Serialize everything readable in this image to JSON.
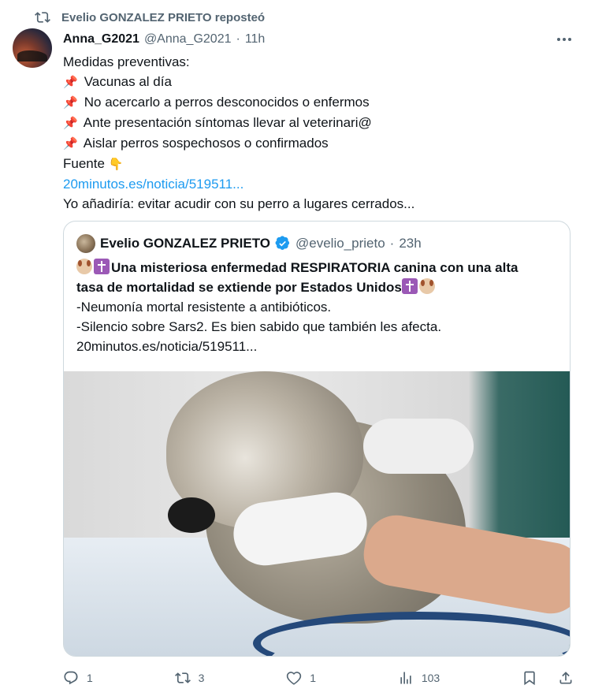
{
  "repost": {
    "label": "Evelio GONZALEZ PRIETO reposteó",
    "icon": "repost-icon"
  },
  "tweet": {
    "author_name": "Anna_G2021",
    "author_handle": "@Anna_G2021",
    "separator": "·",
    "time": "11h",
    "lines": [
      "Medidas preventivas:",
      "Vacunas al día",
      "No acercarlo a perros desconocidos o enfermos",
      "Ante presentación síntomas llevar al veterinari@",
      "Aislar perros sospechosos o confirmados",
      "Fuente",
      "20minutos.es/noticia/519511...",
      "Yo añadiría: evitar acudir con su perro a lugares cerrados..."
    ],
    "pin_icon": "pushpin-icon",
    "pointing_icon": "pointing-down-icon"
  },
  "quote": {
    "author_name": "Evelio GONZALEZ PRIETO",
    "author_handle": "@evelio_prieto",
    "separator": "·",
    "time": "23h",
    "headline_line1": "Una misteriosa enfermedad RESPIRATORIA canina con una alta",
    "headline_line2": "tasa de mortalidad se extiende por Estados Unidos",
    "line3": "-Neumonía mortal resistente a antibióticos.",
    "line4": "-Silencio sobre Sars2. Es bien sabido que también les afecta.",
    "link": "20minutos.es/noticia/519511...",
    "image_desc_icon": "dog-veterinarian-photo"
  },
  "actions": {
    "replies": "1",
    "reposts": "3",
    "likes": "1",
    "views": "103"
  },
  "colors": {
    "link": "#1d9bf0",
    "muted": "#536471",
    "verified": "#1d9bf0",
    "border": "#cfd9de"
  }
}
